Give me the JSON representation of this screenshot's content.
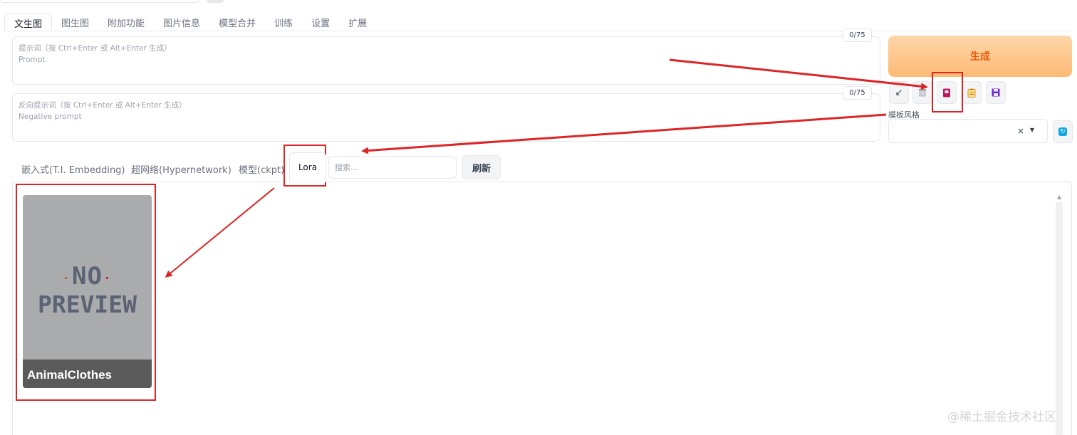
{
  "main_tabs": [
    "文生图",
    "图生图",
    "附加功能",
    "图片信息",
    "模型合并",
    "训练",
    "设置",
    "扩展"
  ],
  "prompt": {
    "placeholder_line1": "提示词（按 Ctrl+Enter 或 Alt+Enter 生成）",
    "placeholder_line2": "Prompt",
    "token_count": "0/75"
  },
  "negative_prompt": {
    "placeholder_line1": "反向提示词（按 Ctrl+Enter 或 Alt+Enter 生成）",
    "placeholder_line2": "Negative prompt",
    "token_count": "0/75"
  },
  "generate_label": "生成",
  "tool_buttons": [
    "arrow-icon",
    "trash-icon",
    "card-icon",
    "clipboard-icon",
    "save-icon"
  ],
  "styles": {
    "label": "模板风格",
    "clear": "×",
    "caret": "▼"
  },
  "network_tabs": [
    "嵌入式(T.I. Embedding)",
    "超网络(Hypernetwork)",
    "模型(ckpt)",
    "Lora"
  ],
  "search_placeholder": "搜索...",
  "refresh_label": "刷新",
  "card": {
    "preview_line1": "NO",
    "preview_line2": "PREVIEW",
    "name": "AnimalClothes"
  },
  "watermark": "@稀土掘金技术社区",
  "colors": {
    "annotation_red": "#dc2626",
    "generate_text": "#ea580c"
  }
}
